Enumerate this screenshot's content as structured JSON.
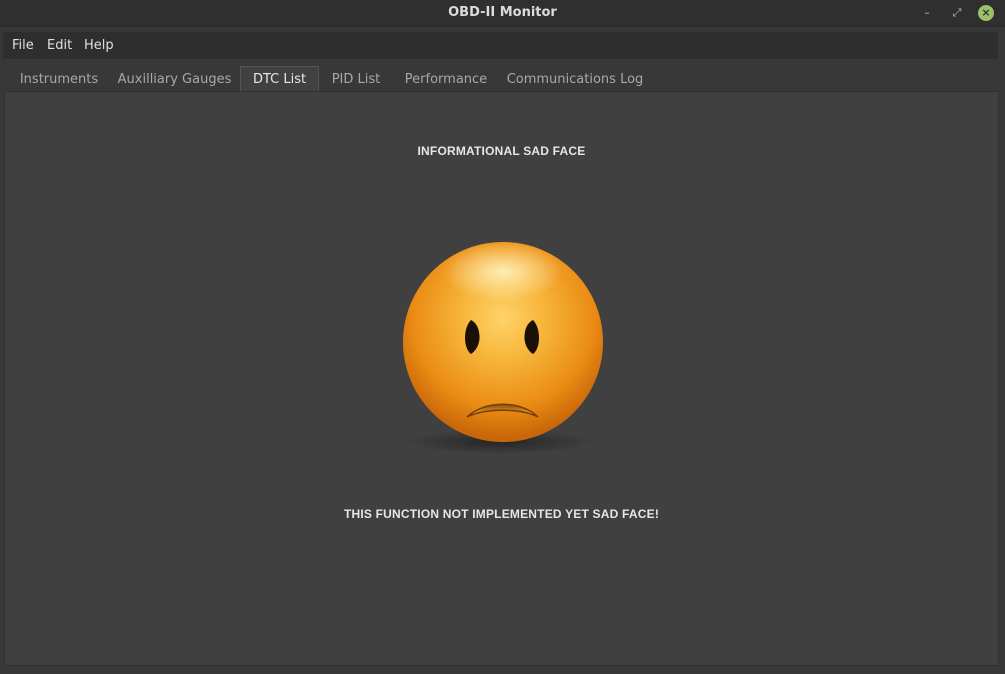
{
  "window": {
    "title": "OBD-II Monitor",
    "minimize_glyph": "–",
    "maximize_glyph": "⤢",
    "close_glyph": "×"
  },
  "menubar": {
    "items": [
      {
        "label": "File"
      },
      {
        "label": "Edit"
      },
      {
        "label": "Help"
      }
    ]
  },
  "tabs": [
    {
      "label": "Instruments",
      "active": false
    },
    {
      "label": "Auxilliary Gauges",
      "active": false
    },
    {
      "label": "DTC List",
      "active": true
    },
    {
      "label": "PID List",
      "active": false
    },
    {
      "label": "Performance",
      "active": false
    },
    {
      "label": "Communications Log",
      "active": false
    }
  ],
  "content": {
    "heading": "INFORMATIONAL SAD FACE",
    "message": "THIS FUNCTION NOT IMPLEMENTED YET SAD FACE!",
    "image_icon": "sad-face-emoticon"
  },
  "colors": {
    "face_main": "#f0a020",
    "face_shadow": "#c86a0a",
    "close_button": "#9bbf6a"
  }
}
